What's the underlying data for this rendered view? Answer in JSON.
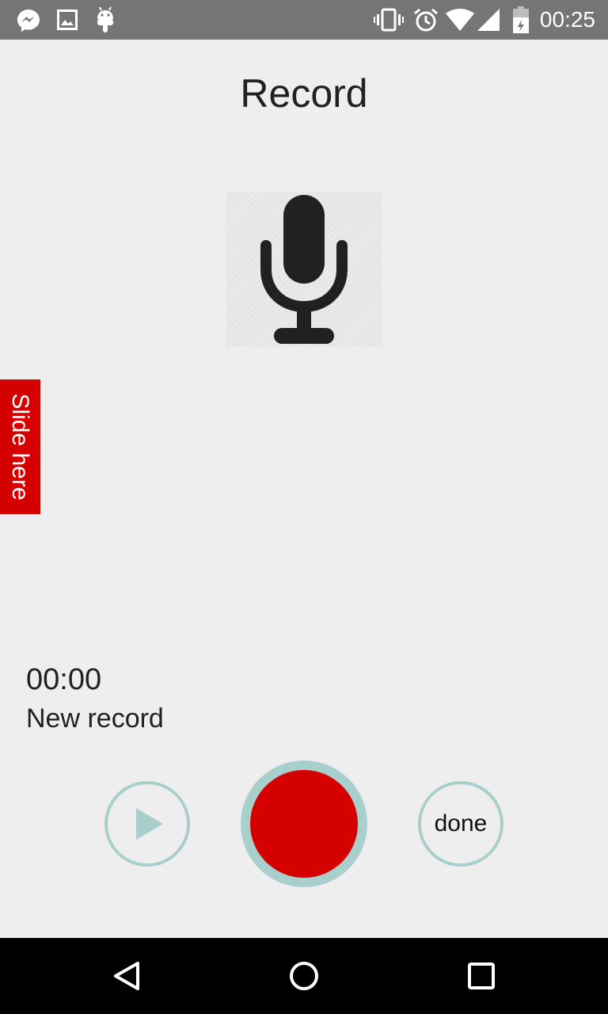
{
  "status_bar": {
    "time": "00:25",
    "left_icons": [
      "messenger-icon",
      "image-icon",
      "android-icon"
    ],
    "right_icons": [
      "vibrate-icon",
      "alarm-icon",
      "wifi-icon",
      "signal-icon",
      "battery-icon"
    ]
  },
  "page": {
    "title": "Record",
    "mic_icon": "microphone-icon"
  },
  "slide_tab": {
    "label": "Slide here",
    "color": "#d50000"
  },
  "recording": {
    "timer": "00:00",
    "name": "New record"
  },
  "controls": {
    "play_icon": "play-icon",
    "record_color": "#d50000",
    "ring_color": "#a9cfcc",
    "done_label": "done"
  },
  "nav_bar": {
    "icons": [
      "back-icon",
      "home-icon",
      "recents-icon"
    ]
  }
}
